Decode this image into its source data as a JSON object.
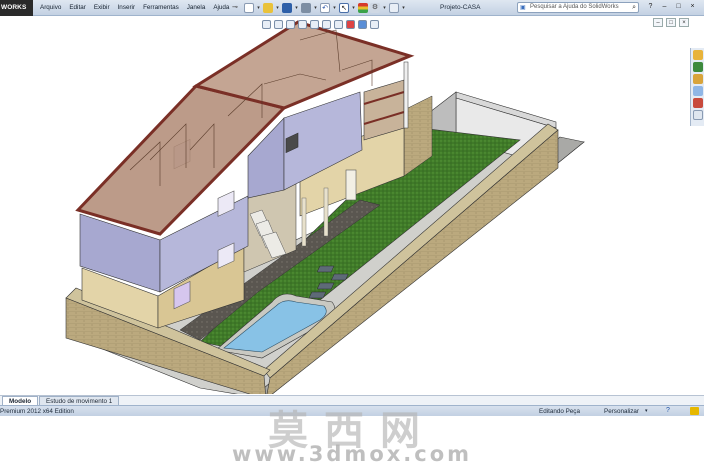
{
  "app": {
    "brand": "WORKS",
    "doc_title": "Projeto-CASA",
    "menu": [
      "Arquivo",
      "Editar",
      "Exibir",
      "Inserir",
      "Ferramentas",
      "Janela",
      "Ajuda"
    ],
    "help_search_placeholder": "Pesquisar a Ajuda do SolidWorks"
  },
  "window_controls": {
    "minimize": "–",
    "restore": "□",
    "close": "×",
    "help": "?"
  },
  "tabs": [
    "Modelo",
    "Estudo de movimento 1"
  ],
  "active_tab": "Modelo",
  "status": {
    "left": "Premium 2012 x64 Edition",
    "mode": "Editando Peça",
    "units": "Personalizar",
    "units_arrow": "▾"
  },
  "watermark": {
    "cn": "莫西网",
    "url": "www.3dmox.com"
  },
  "colors": {
    "wall_purple": "#a7a8d0",
    "wall_beige": "#e3d4a8",
    "roof_glass": "#b08a74",
    "roof_trim": "#7a2f26",
    "grass": "#3f7a28",
    "brick": "#b8a77d",
    "pool_water": "#88c2e6",
    "paving": "#5a5650"
  },
  "icons": {
    "menu_pin": "pin-icon",
    "quick": [
      "new-icon",
      "open-icon",
      "save-icon",
      "print-icon",
      "undo-icon",
      "select-icon",
      "rebuild-icon",
      "options-icon"
    ]
  }
}
